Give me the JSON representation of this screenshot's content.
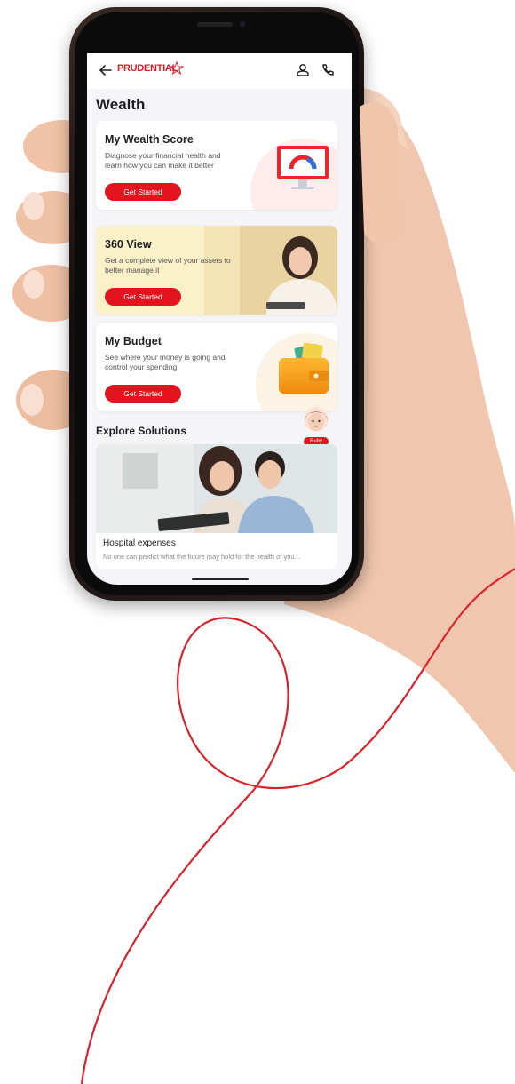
{
  "app": {
    "logo_text": "PRUDENTIAL",
    "page_title": "Wealth"
  },
  "cards": [
    {
      "title": "My Wealth Score",
      "description": "Diagnose your financial health and learn how you can make it better",
      "button": "Get Started"
    },
    {
      "title": "360 View",
      "description": "Get a complete view of your assets to better manage it",
      "button": "Get Started"
    },
    {
      "title": "My Budget",
      "description": "See where your money is going and control your spending",
      "button": "Get Started"
    }
  ],
  "explore": {
    "title": "Explore Solutions",
    "assistant_name": "Ruby",
    "solution": {
      "title": "Hospital expenses",
      "description": "No one can predict what the future may hold for the health of you..."
    }
  },
  "colors": {
    "brand_red": "#e3141e",
    "curve_red": "#d8232a"
  },
  "icons": [
    "back-arrow-icon",
    "prudential-star-icon",
    "person-icon",
    "phone-icon"
  ]
}
